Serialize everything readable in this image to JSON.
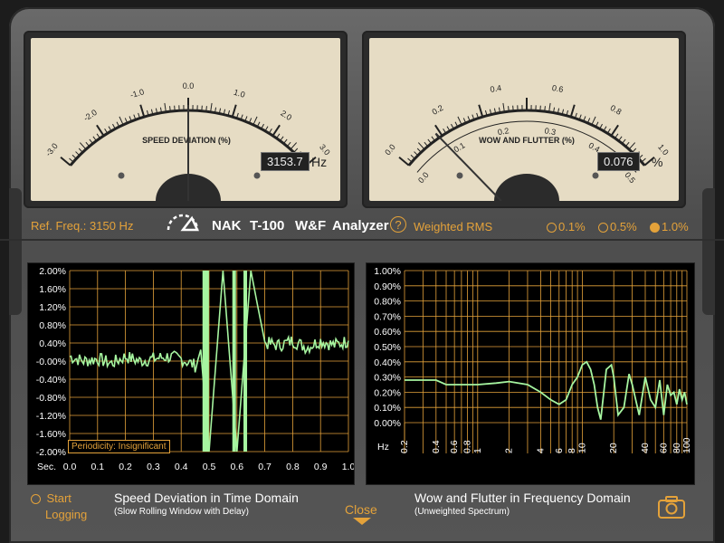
{
  "meters": {
    "speed": {
      "title": "SPEED DEVIATION (%)",
      "ticks": [
        "-3.0",
        "-2.0",
        "-1.0",
        "0.0",
        "1.0",
        "2.0",
        "3.0"
      ],
      "needle_value": 0.0,
      "range": [
        -3.0,
        3.0
      ],
      "readout": "3153.7",
      "unit": "Hz"
    },
    "wow": {
      "title": "WOW AND FLUTTER (%)",
      "outer_ticks": [
        "0.0",
        "0.2",
        "0.4",
        "0.6",
        "0.8",
        "1.0"
      ],
      "inner_ticks": [
        "0.0",
        "0.1",
        "0.2",
        "0.3",
        "0.4",
        "0.5"
      ],
      "needle_value": 0.076,
      "range": [
        0,
        0.5
      ],
      "readout": "0.076",
      "unit": "%"
    }
  },
  "bar": {
    "ref_freq": "Ref. Freq.: 3150 Hz",
    "brand": "NAK",
    "model": "T-100",
    "mode": "W&F",
    "analyzer": "Analyzer",
    "help": "?",
    "weighting": "Weighted RMS",
    "scales": [
      "0.1%",
      "0.5%",
      "1.0%"
    ],
    "selected_scale": "1.0%"
  },
  "left_graph": {
    "y_ticks": [
      "2.00%",
      "1.60%",
      "1.20%",
      "0.80%",
      "0.40%",
      "-0.00%",
      "-0.40%",
      "-0.80%",
      "-1.20%",
      "-1.60%",
      "-2.00%"
    ],
    "x_label": "Sec.",
    "x_ticks": [
      "0.0",
      "0.1",
      "0.2",
      "0.3",
      "0.4",
      "0.5",
      "0.6",
      "0.7",
      "0.8",
      "0.9",
      "1.0"
    ],
    "periodicity": "Periodicity: Insignificant",
    "title": "Speed Deviation in Time Domain",
    "subtitle": "(Slow Rolling Window with Delay)"
  },
  "right_graph": {
    "y_ticks": [
      "1.00%",
      "0.90%",
      "0.80%",
      "0.70%",
      "0.60%",
      "0.50%",
      "0.40%",
      "0.30%",
      "0.20%",
      "0.10%",
      "0.00%"
    ],
    "x_label": "Hz",
    "x_ticks": [
      "0.2",
      "0.4",
      "0.6",
      "0.8",
      "1",
      "2",
      "4",
      "6",
      "8",
      "10",
      "20",
      "40",
      "60",
      "80",
      "100"
    ],
    "title": "Wow and Flutter in Frequency Domain",
    "subtitle": "(Unweighted Spectrum)"
  },
  "footer": {
    "start": "Start",
    "logging": "Logging",
    "close": "Close"
  },
  "colors": {
    "accent": "#e4a23a",
    "trace": "#a6f5a0",
    "meter_face": "#e6dcc4"
  },
  "chart_data": [
    {
      "type": "line",
      "x": [
        0.0,
        0.05,
        0.1,
        0.15,
        0.2,
        0.25,
        0.3,
        0.35,
        0.4,
        0.45,
        0.47,
        0.5,
        0.55,
        0.6,
        0.65,
        0.7,
        0.75,
        0.8,
        0.85,
        0.9,
        0.95,
        1.0
      ],
      "values": [
        0.1,
        0.0,
        0.05,
        -0.05,
        0.1,
        0.0,
        0.05,
        0.1,
        0.05,
        -0.1,
        0.25,
        -2.0,
        2.0,
        -2.0,
        2.0,
        0.4,
        0.35,
        0.45,
        0.3,
        0.45,
        0.35,
        0.45
      ],
      "xlim": [
        0,
        1.0
      ],
      "ylim": [
        -2.0,
        2.0
      ]
    },
    {
      "type": "line",
      "x": [
        0.2,
        0.4,
        0.5,
        0.6,
        0.8,
        1,
        1.5,
        2,
        3,
        4,
        5,
        6,
        7,
        8,
        9,
        10,
        11,
        12,
        13,
        14,
        15,
        17,
        19,
        20,
        22,
        25,
        28,
        30,
        35,
        40,
        45,
        50,
        55,
        60,
        65,
        70,
        75,
        80,
        85,
        90,
        95,
        100
      ],
      "values": [
        0.28,
        0.28,
        0.25,
        0.25,
        0.25,
        0.25,
        0.26,
        0.27,
        0.25,
        0.2,
        0.15,
        0.12,
        0.15,
        0.25,
        0.3,
        0.38,
        0.4,
        0.35,
        0.25,
        0.1,
        0.02,
        0.35,
        0.38,
        0.3,
        0.05,
        0.1,
        0.32,
        0.25,
        0.05,
        0.3,
        0.15,
        0.1,
        0.28,
        0.05,
        0.25,
        0.18,
        0.2,
        0.12,
        0.22,
        0.15,
        0.2,
        0.12
      ],
      "xlim": [
        0.2,
        100
      ],
      "ylim": [
        0,
        1.0
      ]
    }
  ]
}
